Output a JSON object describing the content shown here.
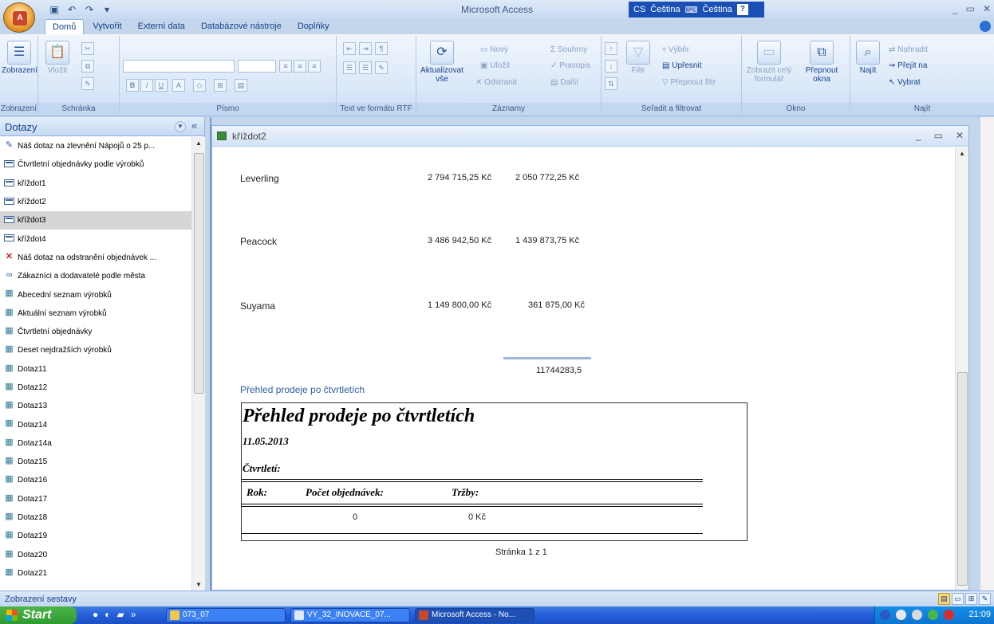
{
  "app": {
    "title": "Microsoft Access",
    "office_logo": "A"
  },
  "langbar": {
    "lang_code": "CS",
    "lang_name": "Čeština",
    "keyboard": "Čeština",
    "help": "?"
  },
  "ribbon_tabs": [
    "Domů",
    "Vytvořit",
    "Externí data",
    "Databázové nástroje",
    "Doplňky"
  ],
  "ribbon": {
    "views": {
      "label": "Zobrazení",
      "group": "Zobrazení"
    },
    "clipboard": {
      "paste": "Vložit",
      "group": "Schránka"
    },
    "font": {
      "group": "Písmo",
      "bold": "B",
      "italic": "I",
      "underline": "U",
      "fontcolor": "A"
    },
    "rtf": {
      "group": "Text ve formátu RTF"
    },
    "records": {
      "refresh": "Aktualizovat vše",
      "new": "Nový",
      "save": "Uložit",
      "delete": "Odstranit",
      "totals": "Souhrny",
      "spelling": "Pravopis",
      "more": "Další",
      "group": "Záznamy"
    },
    "sort": {
      "filter": "Filtr",
      "selection": "Výběr",
      "advanced": "Upřesnit",
      "toggle": "Přepnout filtr",
      "group": "Seřadit a filtrovat"
    },
    "window": {
      "fit": "Zobrazit celý formulář",
      "switch": "Přepnout okna",
      "group": "Okno"
    },
    "find": {
      "find": "Najít",
      "replace": "Nahradit",
      "goto": "Přejít na",
      "select": "Vybrat",
      "group": "Najít"
    }
  },
  "nav": {
    "title": "Dotazy",
    "items": [
      {
        "label": "Náš dotaz na zlevnění Nápojů o 25 p...",
        "icon": "update-query-icon"
      },
      {
        "label": "Čtvrtletní objednávky podle výrobků",
        "icon": "crosstab-query-icon"
      },
      {
        "label": "kříždot1",
        "icon": "crosstab-query-icon"
      },
      {
        "label": "kříždot2",
        "icon": "crosstab-query-icon"
      },
      {
        "label": "kříždot3",
        "icon": "crosstab-query-icon"
      },
      {
        "label": "kříždot4",
        "icon": "crosstab-query-icon"
      },
      {
        "label": "Náš dotaz na odstranění objednávek ...",
        "icon": "delete-query-icon"
      },
      {
        "label": "Zákazníci a dodavatelé podle města",
        "icon": "union-query-icon"
      },
      {
        "label": "Abecední seznam výrobků",
        "icon": "select-query-icon"
      },
      {
        "label": "Aktuální seznam výrobků",
        "icon": "select-query-icon"
      },
      {
        "label": "Čtvrtletní objednávky",
        "icon": "select-query-icon"
      },
      {
        "label": "Deset nejdražších výrobků",
        "icon": "select-query-icon"
      },
      {
        "label": "Dotaz11",
        "icon": "select-query-icon"
      },
      {
        "label": "Dotaz12",
        "icon": "select-query-icon"
      },
      {
        "label": "Dotaz13",
        "icon": "select-query-icon"
      },
      {
        "label": "Dotaz14",
        "icon": "select-query-icon"
      },
      {
        "label": "Dotaz14a",
        "icon": "select-query-icon"
      },
      {
        "label": "Dotaz15",
        "icon": "select-query-icon"
      },
      {
        "label": "Dotaz16",
        "icon": "select-query-icon"
      },
      {
        "label": "Dotaz17",
        "icon": "select-query-icon"
      },
      {
        "label": "Dotaz18",
        "icon": "select-query-icon"
      },
      {
        "label": "Dotaz19",
        "icon": "select-query-icon"
      },
      {
        "label": "Dotaz20",
        "icon": "select-query-icon"
      },
      {
        "label": "Dotaz21",
        "icon": "select-query-icon"
      }
    ],
    "selected_index": 4
  },
  "document": {
    "title": "kříždot2",
    "rows": [
      {
        "name": "Leverling",
        "v1": "2 794 715,25 Kč",
        "v2": "2 050 772,25 Kč"
      },
      {
        "name": "Peacock",
        "v1": "3 486 942,50 Kč",
        "v2": "1 439 873,75 Kč"
      },
      {
        "name": "Suyama",
        "v1": "1 149 800,00 Kč",
        "v2": "361 875,00 Kč"
      }
    ],
    "total": "11744283,5",
    "subreport_label": "Přehled prodeje po čtvrtletích",
    "subreport": {
      "heading": "Přehled prodeje po čtvrtletích",
      "date": "11.05.2013",
      "quarter_label": "Čtvrtletí:",
      "col_year": "Rok:",
      "col_orders": "Počet objednávek:",
      "col_sales": "Tržby:",
      "val_orders": "0",
      "val_sales": "0 Kč"
    },
    "page_number": "Stránka 1 z 1"
  },
  "status": {
    "text": "Zobrazení sestavy"
  },
  "taskbar": {
    "start": "Start",
    "tasks": [
      "073_07",
      "VY_32_INOVACE_07...",
      "Microsoft Access - No..."
    ],
    "clock": "21:09"
  },
  "colors": {
    "ribbon_text": "#15428b",
    "frame": "#c4d6ec",
    "taskbar": "#245edb",
    "start": "#2f9a2f"
  }
}
